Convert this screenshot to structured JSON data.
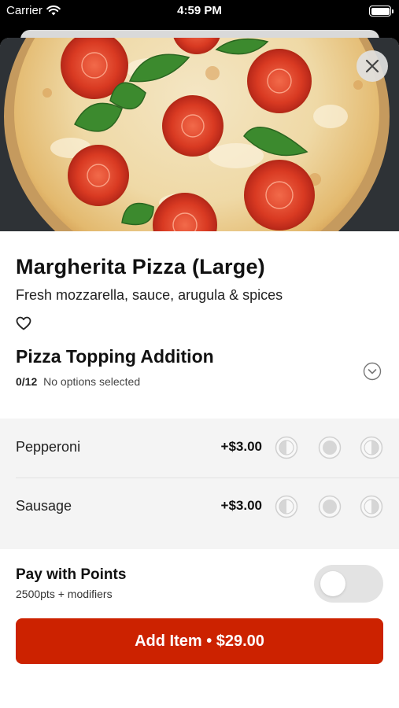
{
  "status_bar": {
    "carrier": "Carrier",
    "time": "4:59 PM"
  },
  "item": {
    "title": "Margherita Pizza (Large)",
    "description": "Fresh mozzarella, sauce, arugula & spices"
  },
  "modifier_group": {
    "title": "Pizza Topping Addition",
    "count": "0/12",
    "status": "No options selected"
  },
  "options": [
    {
      "name": "Pepperoni",
      "price": "+$3.00"
    },
    {
      "name": "Sausage",
      "price": "+$3.00"
    }
  ],
  "pay_with_points": {
    "title": "Pay with Points",
    "subtitle": "2500pts + modifiers",
    "enabled": false
  },
  "add_button": {
    "label": "Add Item • $29.00"
  },
  "colors": {
    "accent": "#cc2200",
    "options_bg": "#f4f4f4",
    "toggle_off": "#e3e3e3"
  },
  "icons": {
    "close": "close-icon",
    "favorite": "heart-outline-icon",
    "expand": "chevron-down-circle-icon",
    "portion_left": "left-half-icon",
    "portion_whole": "whole-icon",
    "portion_right": "right-half-icon"
  }
}
